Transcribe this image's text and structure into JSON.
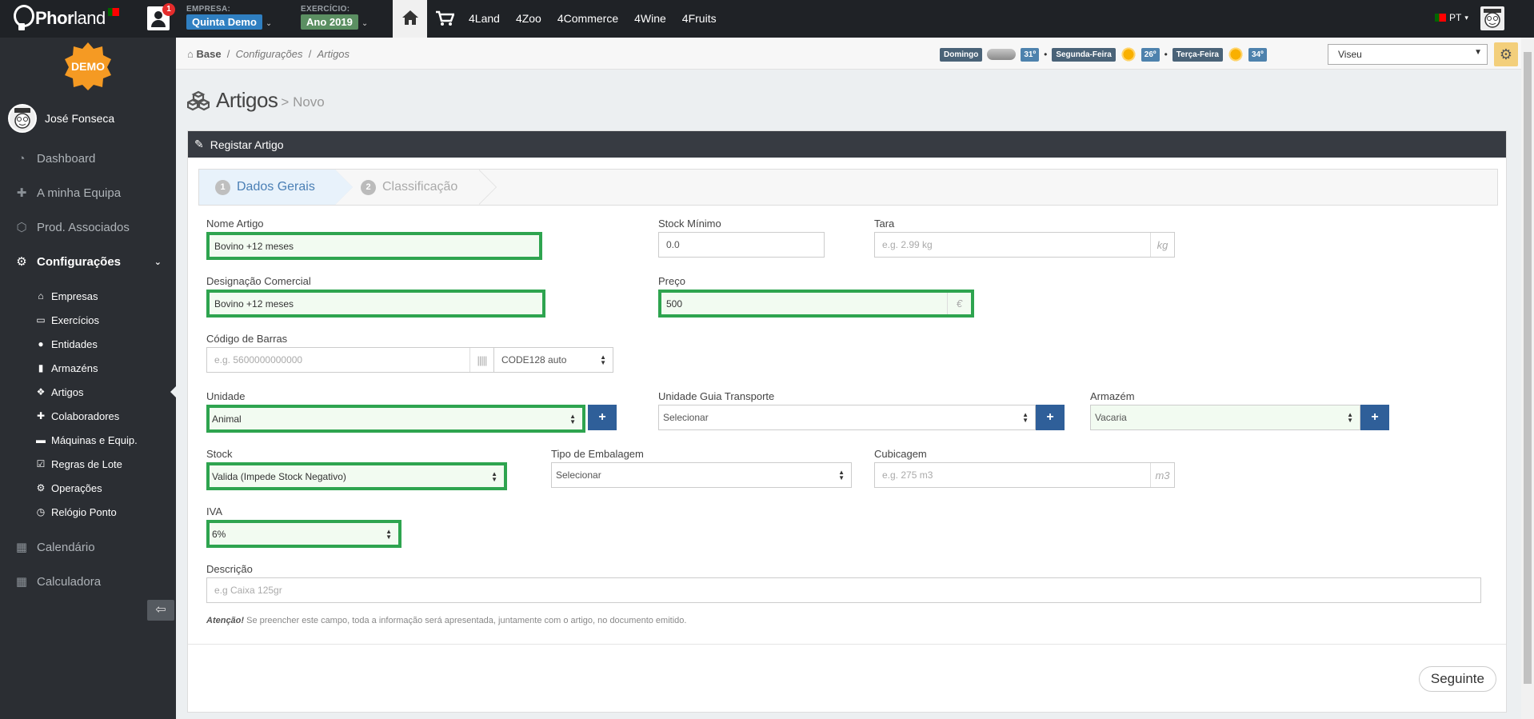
{
  "topbar": {
    "logo_main": "Phor",
    "logo_rest": "land",
    "notifications": "1",
    "empresa_label": "EMPRESA:",
    "empresa_value": "Quinta Demo",
    "exercicio_label": "EXERCÍCIO:",
    "exercicio_value": "Ano 2019",
    "nav": [
      "4Land",
      "4Zoo",
      "4Commerce",
      "4Wine",
      "4Fruits"
    ],
    "lang": "PT",
    "colors": {
      "empresa": "#2f7fc1",
      "exercicio": "#5b8f62"
    }
  },
  "sidebar": {
    "demo_badge": "DEMO",
    "user_name": "José Fonseca",
    "items": [
      {
        "label": "Dashboard",
        "icon": "dashboard-icon"
      },
      {
        "label": "A minha Equipa",
        "icon": "team-icon"
      },
      {
        "label": "Prod. Associados",
        "icon": "associates-icon"
      },
      {
        "label": "Configurações",
        "icon": "gears-icon"
      }
    ],
    "subitems": [
      {
        "label": "Empresas",
        "icon": "home-icon"
      },
      {
        "label": "Exercícios",
        "icon": "calendar-icon"
      },
      {
        "label": "Entidades",
        "icon": "users-icon"
      },
      {
        "label": "Armazéns",
        "icon": "book-icon"
      },
      {
        "label": "Artigos",
        "icon": "cubes-icon"
      },
      {
        "label": "Colaboradores",
        "icon": "user-plus-icon"
      },
      {
        "label": "Máquinas e Equip.",
        "icon": "car-icon"
      },
      {
        "label": "Regras de Lote",
        "icon": "calendar-check-icon"
      },
      {
        "label": "Operações",
        "icon": "cogs-icon"
      },
      {
        "label": "Relógio Ponto",
        "icon": "clock-icon"
      }
    ],
    "bottom_items": [
      {
        "label": "Calendário",
        "icon": "calendar-icon"
      },
      {
        "label": "Calculadora",
        "icon": "calculator-icon"
      }
    ]
  },
  "breadcrumb": {
    "base": "Base",
    "sep": "/",
    "c1": "Configurações",
    "c2": "Artigos"
  },
  "weather": {
    "days": [
      {
        "day": "Domingo",
        "temp": "31º",
        "icon": "cloud-icon"
      },
      {
        "day": "Segunda-Feira",
        "temp": "26º",
        "icon": "sun-icon"
      },
      {
        "day": "Terça-Feira",
        "temp": "34º",
        "icon": "sun-icon"
      }
    ],
    "city": "Viseu"
  },
  "page": {
    "title": "Artigos",
    "subtitle": "> Novo"
  },
  "panel": {
    "title": "Registar Artigo"
  },
  "steps": [
    {
      "num": "1",
      "label": "Dados Gerais"
    },
    {
      "num": "2",
      "label": "Classificação"
    }
  ],
  "form": {
    "nome_artigo": {
      "label": "Nome Artigo",
      "value": "Bovino +12 meses"
    },
    "stock_minimo": {
      "label": "Stock Mínimo",
      "value": "0.0"
    },
    "tara": {
      "label": "Tara",
      "placeholder": "e.g. 2.99 kg",
      "addon": "kg"
    },
    "designacao": {
      "label": "Designação Comercial",
      "value": "Bovino +12 meses"
    },
    "preco": {
      "label": "Preço",
      "value": "500",
      "addon": "€"
    },
    "codigo_barras": {
      "label": "Código de Barras",
      "placeholder": "e.g. 5600000000000",
      "type": "CODE128 auto"
    },
    "unidade": {
      "label": "Unidade",
      "value": "Animal"
    },
    "unidade_guia": {
      "label": "Unidade Guia Transporte",
      "value": "Selecionar"
    },
    "armazem": {
      "label": "Armazém",
      "value": "Vacaria"
    },
    "stock": {
      "label": "Stock",
      "value": "Valida (Impede Stock Negativo)"
    },
    "tipo_embalagem": {
      "label": "Tipo de Embalagem",
      "value": "Selecionar"
    },
    "cubicagem": {
      "label": "Cubicagem",
      "placeholder": "e.g. 275 m3",
      "addon": "m3"
    },
    "iva": {
      "label": "IVA",
      "value": "6%"
    },
    "descricao": {
      "label": "Descrição",
      "placeholder": "e.g Caixa 125gr"
    },
    "hint_bold": "Atenção!",
    "hint_text": " Se preencher este campo, toda a informação será apresentada, juntamente com o artigo, no documento emitido."
  },
  "actions": {
    "next": "Seguinte",
    "plus": "+"
  }
}
